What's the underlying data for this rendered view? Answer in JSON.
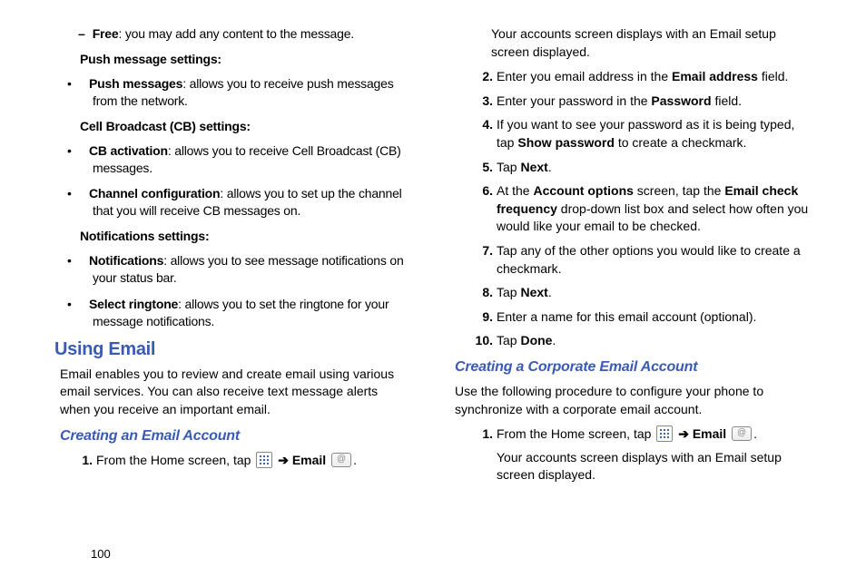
{
  "pageNumber": "100",
  "col1": {
    "freeItem": {
      "label": "Free",
      "text": ": you may add any content to the message."
    },
    "pushHead": "Push message settings:",
    "pushMsg": {
      "label": "Push messages",
      "text": ": allows you to receive push messages from the network."
    },
    "cbHead": "Cell Broadcast (CB) settings:",
    "cbAct": {
      "label": "CB activation",
      "text": ": allows you to receive Cell Broadcast (CB) messages."
    },
    "chanCfg": {
      "label": "Channel configuration",
      "text": ": allows you to set up the channel that you will receive CB messages on."
    },
    "notifHead": "Notifications settings:",
    "notif": {
      "label": "Notifications",
      "text": ": allows you to see message notifications on your status bar."
    },
    "ringtone": {
      "label": "Select ringtone",
      "text": ": allows you to set the ringtone for your message notifications."
    },
    "h1": "Using Email",
    "intro": "Email enables you to review and create email using various email services. You can also receive text message alerts when you receive an important email.",
    "h2a": "Creating an Email Account",
    "step1a": "From the Home screen, tap ",
    "step1arrow": "➔",
    "step1email": "Email",
    "step1dot": "."
  },
  "col2": {
    "cont": "Your accounts screen displays with an Email setup screen displayed.",
    "s2a": "Enter you email address in the ",
    "s2b": "Email address",
    "s2c": " field.",
    "s3a": "Enter your password in the ",
    "s3b": "Password",
    "s3c": " field.",
    "s4a": "If you want to see your password as it is being typed, tap ",
    "s4b": "Show password",
    "s4c": " to create a checkmark.",
    "s5a": "Tap ",
    "s5b": "Next",
    "s5c": ".",
    "s6a": "At the ",
    "s6b": "Account options",
    "s6c": " screen, tap the ",
    "s6d": "Email check frequency",
    "s6e": " drop-down list box and select how often you would like your email to be checked.",
    "s7": "Tap any of the other options you would like to create a checkmark.",
    "s8a": "Tap ",
    "s8b": "Next",
    "s8c": ".",
    "s9": "Enter a name for this email account (optional).",
    "s10a": "Tap ",
    "s10b": "Done",
    "s10c": ".",
    "h2b": "Creating a Corporate Email Account",
    "corpIntro": "Use the following procedure to configure your phone to synchronize with a corporate email account.",
    "cs1a": "From the Home screen, tap ",
    "cs1arrow": "➔",
    "cs1email": "Email",
    "cs1dot": ".",
    "cs1cont": "Your accounts screen displays with an Email setup screen displayed."
  }
}
